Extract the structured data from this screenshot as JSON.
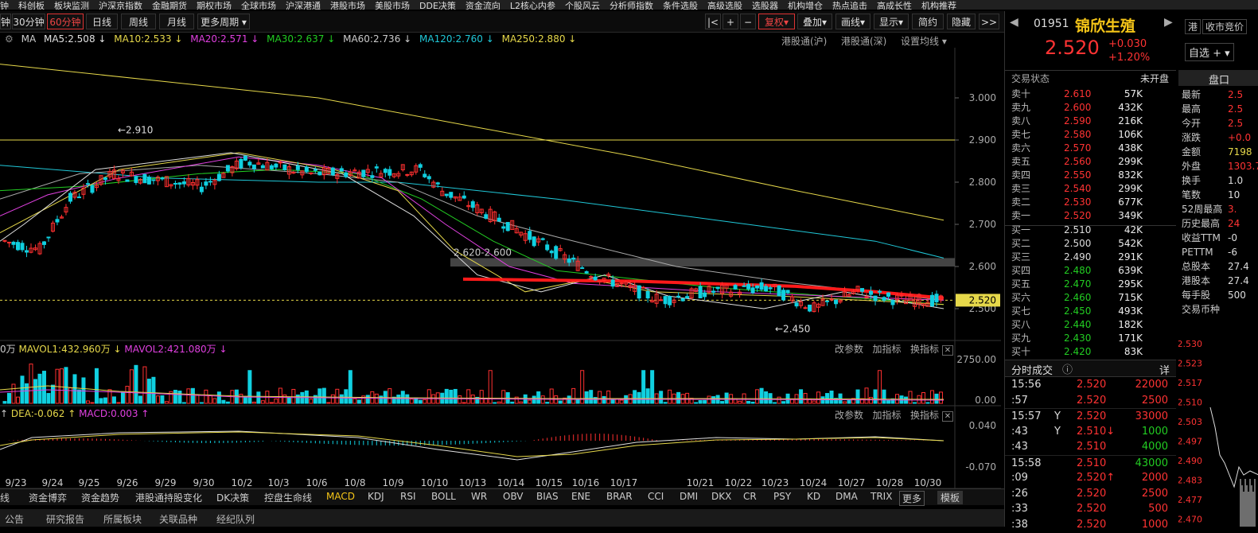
{
  "top_menu": [
    "钟",
    "科创板",
    "板块监测",
    "沪深京指数",
    "金融期货",
    "期权市场",
    "全球市场",
    "沪深港通",
    "港股市场",
    "美股市场",
    "DDE决策",
    "资金流向",
    "L2核心内参",
    "个股风云",
    "分析师指数",
    "条件选股",
    "高级选股",
    "选股器",
    "机构增仓",
    "热点追击",
    "高成长性",
    "机构推荐"
  ],
  "period_tabs": [
    "钟",
    "30分钟",
    "60分钟",
    "日线",
    "周线",
    "月线",
    "更多周期"
  ],
  "active_period": "60分钟",
  "toolbar_right": [
    "|<",
    "+",
    "−",
    "复权",
    "叠加",
    "画线",
    "显示",
    "简约",
    "隐藏",
    ">>"
  ],
  "ma_bar": {
    "label": "MA",
    "ma5": "MA5:2.508 ↓",
    "ma10": "MA10:2.533 ↓",
    "ma20": "MA20:2.571 ↓",
    "ma30": "MA30:2.637 ↓",
    "ma60": "MA60:2.736 ↓",
    "ma120": "MA120:2.760 ↓",
    "ma250": "MA250:2.880 ↓",
    "hgt_sh": "港股通(沪)",
    "hgt_sz": "港股通(深)",
    "set_ma": "设置均线"
  },
  "colors": {
    "ma5": "#e0e0e0",
    "ma10": "#e6d84a",
    "ma20": "#e040e0",
    "ma30": "#22cc22",
    "ma60": "#aaaaaa",
    "ma120": "#20c8d8",
    "ma250": "#e6d84a",
    "up": "#ff3030",
    "down": "#10d0e0",
    "grid": "#222222"
  },
  "chart_data": {
    "type": "candlestick",
    "price_axis": [
      "3.000",
      "2.900",
      "2.800",
      "2.700",
      "2.600",
      "2.500"
    ],
    "current_price_label": "2.520",
    "high_annotation": "2.910",
    "low_annotation": "2.450",
    "zone_label": "2.620-2.600",
    "x_labels": [
      "9/23",
      "9/24",
      "9/25",
      "9/26",
      "9/29",
      "9/30",
      "10/2",
      "10/3",
      "10/6",
      "10/8",
      "10/9",
      "10/10",
      "10/13",
      "10/14",
      "10/15",
      "10/16",
      "10/17",
      "10/21",
      "10/22",
      "10/23",
      "10/24",
      "10/27",
      "10/28",
      "10/30"
    ],
    "volume_axis": [
      "2750.00",
      "0.00"
    ],
    "macd_axis": [
      "0.040",
      "-0.070"
    ]
  },
  "vol_bar": {
    "prefix": "0万",
    "mavol1": "MAVOL1:432.960万 ↓",
    "mavol2": "MAVOL2:421.080万 ↓"
  },
  "macd_bar": {
    "prefix": "↑",
    "dea": "DEA:-0.062 ↑",
    "macd": "MACD:0.003 ↑"
  },
  "pane_buttons": [
    "改参数",
    "加指标",
    "换指标"
  ],
  "indicator_tabs": [
    "线",
    "资金博弈",
    "资金趋势",
    "港股通持股变化",
    "DK决策",
    "控盘生命线",
    "MACD",
    "KDJ",
    "RSI",
    "BOLL",
    "WR",
    "OBV",
    "BIAS",
    "ENE",
    "BRAR",
    "CCI",
    "DMI",
    "DKX",
    "CR",
    "PSY",
    "KD",
    "DMA",
    "TRIX",
    "更多",
    "模板"
  ],
  "active_indicator": "MACD",
  "bottom_tabs": [
    "公告",
    "研究报告",
    "所属板块",
    "关联品种",
    "经纪队列"
  ],
  "stock": {
    "code": "01951",
    "name": "锦欣生殖",
    "price": "2.520",
    "change": "+0.030",
    "change_pct": "+1.20%",
    "tag_hk": "港",
    "close_auction": "收市竞价",
    "watchlist": "自选 +"
  },
  "trade_status": {
    "label": "交易状态",
    "value": "未开盘"
  },
  "order_book": {
    "asks": [
      {
        "l": "卖十",
        "p": "2.610",
        "v": "57K"
      },
      {
        "l": "卖九",
        "p": "2.600",
        "v": "432K"
      },
      {
        "l": "卖八",
        "p": "2.590",
        "v": "216K"
      },
      {
        "l": "卖七",
        "p": "2.580",
        "v": "106K"
      },
      {
        "l": "卖六",
        "p": "2.570",
        "v": "438K"
      },
      {
        "l": "卖五",
        "p": "2.560",
        "v": "299K"
      },
      {
        "l": "卖四",
        "p": "2.550",
        "v": "832K"
      },
      {
        "l": "卖三",
        "p": "2.540",
        "v": "299K"
      },
      {
        "l": "卖二",
        "p": "2.530",
        "v": "677K"
      },
      {
        "l": "卖一",
        "p": "2.520",
        "v": "349K"
      }
    ],
    "bids": [
      {
        "l": "买一",
        "p": "2.510",
        "v": "42K"
      },
      {
        "l": "买二",
        "p": "2.500",
        "v": "542K"
      },
      {
        "l": "买三",
        "p": "2.490",
        "v": "291K"
      },
      {
        "l": "买四",
        "p": "2.480",
        "v": "639K"
      },
      {
        "l": "买五",
        "p": "2.470",
        "v": "295K"
      },
      {
        "l": "买六",
        "p": "2.460",
        "v": "715K"
      },
      {
        "l": "买七",
        "p": "2.450",
        "v": "493K"
      },
      {
        "l": "买八",
        "p": "2.440",
        "v": "182K"
      },
      {
        "l": "买九",
        "p": "2.430",
        "v": "171K"
      },
      {
        "l": "买十",
        "p": "2.420",
        "v": "83K"
      }
    ]
  },
  "trades_header": {
    "label": "分时成交",
    "detail": "详"
  },
  "trades": [
    {
      "t": "15:56",
      "f": "",
      "p": "2.520",
      "v": "22000",
      "pc": "red",
      "vc": "red"
    },
    {
      "t": ":57",
      "f": "",
      "p": "2.520",
      "v": "2500",
      "pc": "red",
      "vc": "red"
    },
    {
      "t": "15:57",
      "f": "Y",
      "p": "2.520",
      "v": "33000",
      "pc": "red",
      "vc": "red"
    },
    {
      "t": ":43",
      "f": "Y",
      "p": "2.510↓",
      "v": "1000",
      "pc": "red",
      "vc": "green"
    },
    {
      "t": ":43",
      "f": "",
      "p": "2.510",
      "v": "4000",
      "pc": "red",
      "vc": "green"
    },
    {
      "t": "15:58",
      "f": "",
      "p": "2.510",
      "v": "43000",
      "pc": "red",
      "vc": "green"
    },
    {
      "t": ":09",
      "f": "",
      "p": "2.520↑",
      "v": "2000",
      "pc": "red",
      "vc": "red"
    },
    {
      "t": ":26",
      "f": "",
      "p": "2.520",
      "v": "2500",
      "pc": "red",
      "vc": "red"
    },
    {
      "t": ":33",
      "f": "",
      "p": "2.520",
      "v": "500",
      "pc": "red",
      "vc": "red"
    },
    {
      "t": ":38",
      "f": "",
      "p": "2.520",
      "v": "1000",
      "pc": "red",
      "vc": "red"
    }
  ],
  "quote_tab": "盘口",
  "stats": [
    {
      "l": "最新",
      "v": "2.5"
    },
    {
      "l": "最高",
      "v": "2.5"
    },
    {
      "l": "今开",
      "v": "2.5"
    },
    {
      "l": "涨跌",
      "v": "+0.0"
    },
    {
      "l": "金额",
      "v": "7198"
    },
    {
      "l": "外盘",
      "v": "1303.7"
    },
    {
      "l": "换手",
      "v": "1.0"
    },
    {
      "l": "笔数",
      "v": "10"
    },
    {
      "l": "52周最高",
      "v": "3."
    },
    {
      "l": "历史最高",
      "v": "24"
    },
    {
      "l": "收益TTM",
      "v": "-0"
    },
    {
      "l": "PETTM",
      "v": "-6"
    },
    {
      "l": "总股本",
      "v": "27.4"
    },
    {
      "l": "港股本",
      "v": "27.4"
    },
    {
      "l": "每手股",
      "v": "500"
    },
    {
      "l": "交易币种",
      "v": ""
    }
  ],
  "mini_axis": [
    "2.530",
    "2.523",
    "2.517",
    "2.510",
    "2.503",
    "2.497",
    "2.490",
    "2.483",
    "2.477",
    "2.470"
  ]
}
